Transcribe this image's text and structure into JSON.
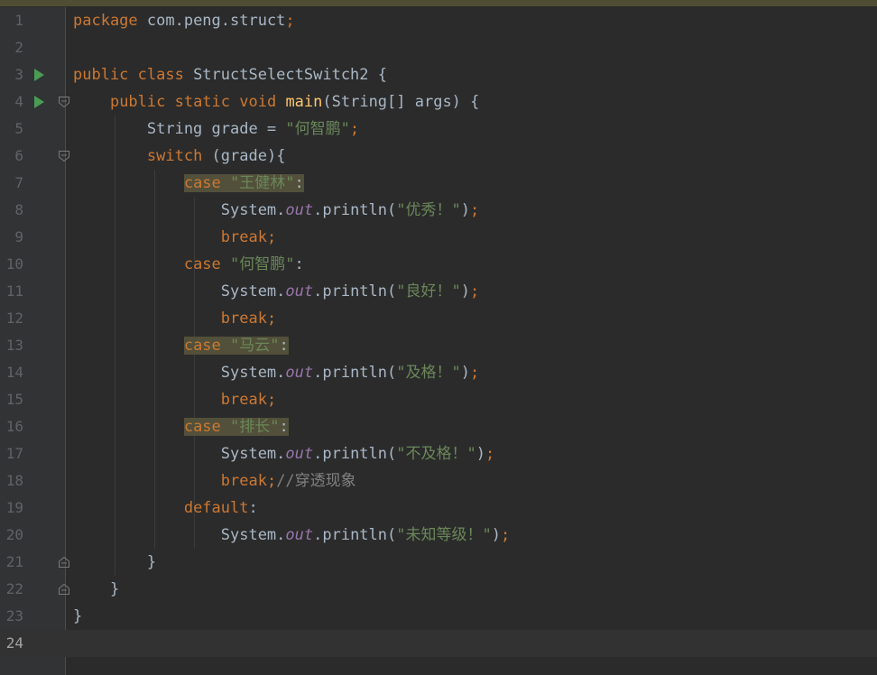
{
  "editor": {
    "current_line": 24,
    "lines": [
      {
        "n": "1",
        "html": "<span class='kw'>package</span> com.peng.struct<span class='kw'>;</span>"
      },
      {
        "n": "2",
        "html": ""
      },
      {
        "n": "3",
        "run": true,
        "html": "<span class='kw'>public class</span> StructSelectSwitch2 {"
      },
      {
        "n": "4",
        "run": true,
        "fold": "open",
        "html": "    <span class='kw'>public static void</span> <span class='fn'>main</span>(String[] args) {"
      },
      {
        "n": "5",
        "html": "        String grade = <span class='str'>\"何智鹏\"</span><span class='kw'>;</span>"
      },
      {
        "n": "6",
        "fold": "open",
        "html": "        <span class='kw'>switch</span> (grade){"
      },
      {
        "n": "7",
        "html": "            <span class='hl'><span class='kw'>case</span> <span class='str'>\"王健林\"</span>:</span>"
      },
      {
        "n": "8",
        "html": "                System.<span class='field'>out</span>.println(<span class='str'>\"优秀！\"</span>)<span class='kw'>;</span>"
      },
      {
        "n": "9",
        "html": "                <span class='kw'>break;</span>"
      },
      {
        "n": "10",
        "html": "            <span class='kw'>case</span> <span class='str'>\"何智鹏\"</span>:"
      },
      {
        "n": "11",
        "html": "                System.<span class='field'>out</span>.println(<span class='str'>\"良好！\"</span>)<span class='kw'>;</span>"
      },
      {
        "n": "12",
        "html": "                <span class='kw'>break;</span>"
      },
      {
        "n": "13",
        "html": "            <span class='hl'><span class='kw'>case</span> <span class='str'>\"马云\"</span>:</span>"
      },
      {
        "n": "14",
        "html": "                System.<span class='field'>out</span>.println(<span class='str'>\"及格！\"</span>)<span class='kw'>;</span>"
      },
      {
        "n": "15",
        "html": "                <span class='kw'>break;</span>"
      },
      {
        "n": "16",
        "html": "            <span class='hl'><span class='kw'>case</span> <span class='str'>\"排长\"</span>:</span>"
      },
      {
        "n": "17",
        "html": "                System.<span class='field'>out</span>.println(<span class='str'>\"不及格！\"</span>)<span class='kw'>;</span>"
      },
      {
        "n": "18",
        "html": "                <span class='kw'>break;</span><span class='cmt'>//穿透现象</span>"
      },
      {
        "n": "19",
        "html": "            <span class='kw'>default</span>:"
      },
      {
        "n": "20",
        "html": "                System.<span class='field'>out</span>.println(<span class='str'>\"未知等级！\"</span>)<span class='kw'>;</span>"
      },
      {
        "n": "21",
        "fold": "close",
        "html": "        }"
      },
      {
        "n": "22",
        "fold": "close",
        "html": "    }"
      },
      {
        "n": "23",
        "html": "}"
      },
      {
        "n": "24",
        "html": ""
      }
    ]
  },
  "colors": {
    "background": "#2b2b2b",
    "gutter": "#313335",
    "keyword": "#cc7832",
    "string": "#6a8759",
    "method": "#ffc66d",
    "field": "#9876aa",
    "comment": "#808080",
    "highlight": "#52503a"
  },
  "icons": {
    "run": "run-gutter-icon",
    "fold_open": "fold-open-icon",
    "fold_close": "fold-close-icon"
  }
}
